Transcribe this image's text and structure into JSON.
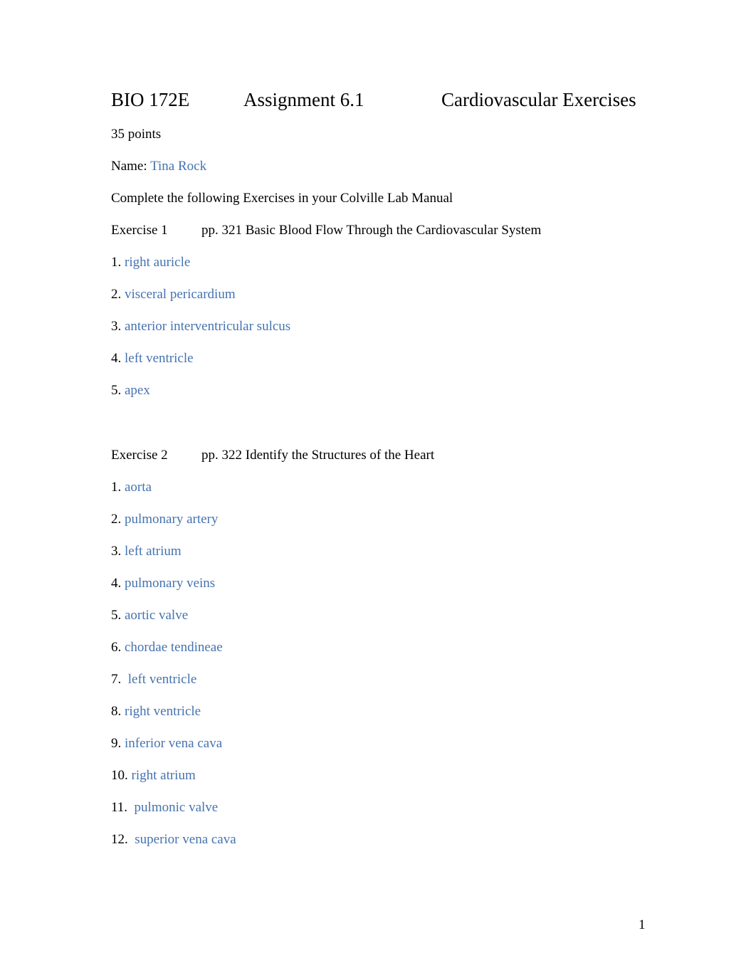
{
  "document": {
    "title_parts": {
      "course": "BIO 172E",
      "assignment": "Assignment 6.1",
      "subject": "Cardiovascular Exercises"
    },
    "points": "35 points",
    "name_label": "Name:",
    "name_value": "Tina Rock",
    "instruction": "Complete the following Exercises in your Colville Lab Manual",
    "page_number": "1",
    "answer_color": "#4573b0",
    "text_color": "#000000",
    "background_color": "#ffffff"
  },
  "exercises": [
    {
      "label": "Exercise 1",
      "reference": "pp. 321 Basic Blood Flow Through the Cardiovascular System",
      "items": [
        {
          "num": "1.",
          "value": "right auricle"
        },
        {
          "num": "2.",
          "value": "visceral pericardium"
        },
        {
          "num": "3.",
          "value": "anterior interventricular sulcus"
        },
        {
          "num": "4.",
          "value": "left ventricle"
        },
        {
          "num": "5.",
          "value": "apex"
        }
      ]
    },
    {
      "label": "Exercise 2",
      "reference": "pp. 322 Identify the Structures of the Heart",
      "items": [
        {
          "num": "1.",
          "value": "aorta"
        },
        {
          "num": "2.",
          "value": "pulmonary artery"
        },
        {
          "num": "3.",
          "value": "left atrium"
        },
        {
          "num": "4.",
          "value": "pulmonary veins"
        },
        {
          "num": "5.",
          "value": "aortic valve"
        },
        {
          "num": "6.",
          "value": "chordae tendineae"
        },
        {
          "num": "7.",
          "value": " left ventricle"
        },
        {
          "num": "8.",
          "value": "right ventricle"
        },
        {
          "num": "9.",
          "value": "inferior vena cava"
        },
        {
          "num": "10.",
          "value": "right atrium"
        },
        {
          "num": "11.",
          "value": " pulmonic valve"
        },
        {
          "num": "12.",
          "value": " superior vena cava"
        }
      ]
    }
  ]
}
